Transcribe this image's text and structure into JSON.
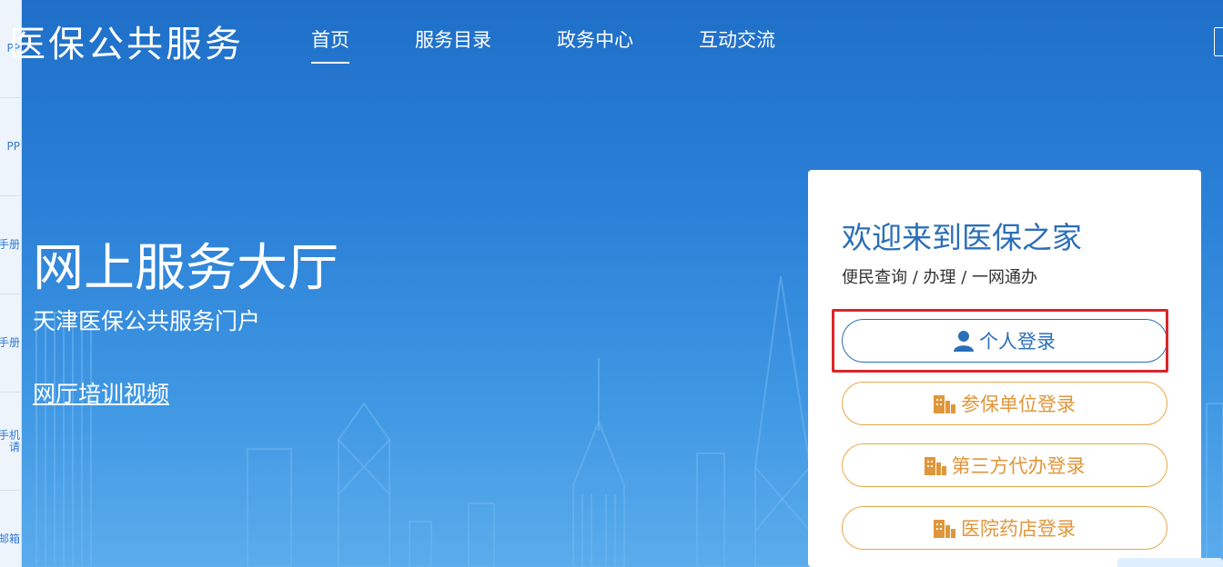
{
  "header": {
    "logo": "医保公共服务",
    "nav": [
      {
        "label": "首页",
        "active": true
      },
      {
        "label": "服务目录",
        "active": false
      },
      {
        "label": "政务中心",
        "active": false
      },
      {
        "label": "互动交流",
        "active": false
      }
    ]
  },
  "sidebar": {
    "items": [
      "PP",
      "PP",
      "手册",
      "手册",
      "手机\n请",
      "邮箱"
    ]
  },
  "hero": {
    "title": "网上服务大厅",
    "subtitle": "天津医保公共服务门户",
    "link": "网厅培训视频"
  },
  "login_card": {
    "title": "欢迎来到医保之家",
    "subtitle": "便民查询 / 办理 / 一网通办",
    "buttons": {
      "personal": "个人登录",
      "organization": "参保单位登录",
      "agent": "第三方代办登录",
      "hospital": "医院药店登录"
    }
  },
  "colors": {
    "primary_blue": "#2b6fb8",
    "accent_orange": "#e0963a",
    "highlight_red": "#d9262b"
  }
}
